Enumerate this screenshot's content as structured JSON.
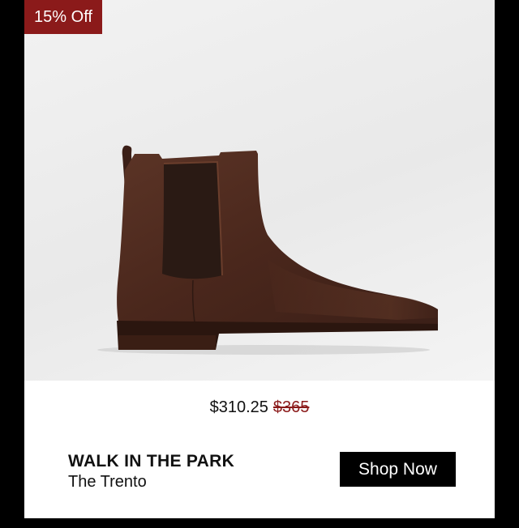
{
  "badge": {
    "text": "15% Off"
  },
  "product": {
    "sale_price": "$310.25",
    "original_price": "$365",
    "title": "WALK IN THE PARK",
    "name": "The Trento",
    "image_icon": "chelsea-boot-image"
  },
  "cta": {
    "label": "Shop Now"
  },
  "colors": {
    "badge_bg": "#8b1a1a",
    "button_bg": "#000000",
    "boot": "#4e2a1e"
  }
}
